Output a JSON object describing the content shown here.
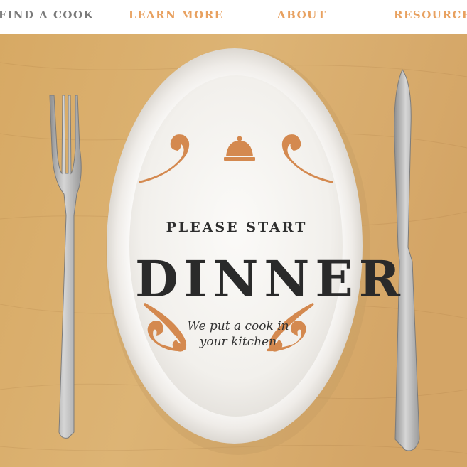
{
  "nav": {
    "items": [
      {
        "label": "FIND A COOK"
      },
      {
        "label": "LEARN MORE"
      },
      {
        "label": "ABOUT"
      },
      {
        "label": "RESOURCES"
      }
    ]
  },
  "hero": {
    "kicker": "PLEASE START",
    "title": "DINNER",
    "tagline_line1": "We put a cook in",
    "tagline_line2": "your kitchen"
  },
  "colors": {
    "accent": "#e8a160",
    "ornament": "#d4894f",
    "table": "#d9ae6e",
    "plate": "#f6f4f1"
  },
  "icons": [
    "cloche-icon",
    "fork-icon",
    "knife-icon",
    "ornament-icon"
  ]
}
